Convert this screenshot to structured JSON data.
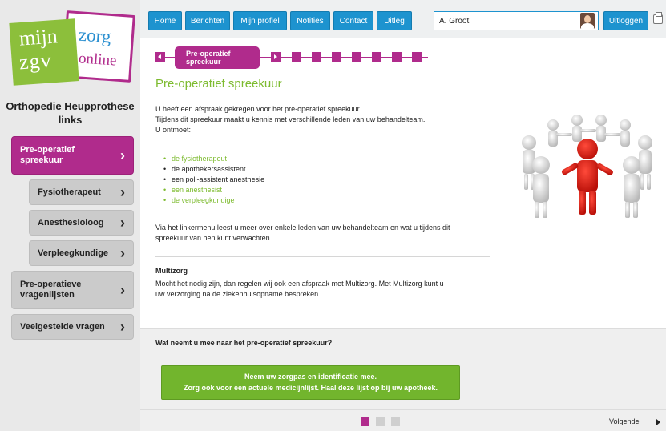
{
  "logo": {
    "word1": "mijn",
    "word2": "zorg",
    "word3": "zgv",
    "word4": "online"
  },
  "sidebar": {
    "section_title": "Orthopedie Heupprothese links",
    "items": [
      {
        "label": "Pre-operatief spreekuur",
        "active": true
      },
      {
        "label": "Fysiotherapeut"
      },
      {
        "label": "Anesthesioloog"
      },
      {
        "label": "Verpleegkundige"
      },
      {
        "label": "Pre-operatieve vragenlijsten"
      },
      {
        "label": "Veelgestelde vragen"
      }
    ]
  },
  "topbar": {
    "tabs": [
      "Home",
      "Berichten",
      "Mijn profiel",
      "Notities",
      "Contact",
      "Uitleg"
    ],
    "user_name": "A. Groot",
    "logout_label": "Uitloggen"
  },
  "progress": {
    "current_step": "Pre-operatief spreekuur",
    "total_steps": 9,
    "current_index": 1
  },
  "content": {
    "title": "Pre-operatief spreekuur",
    "intro_1": "U heeft een afspraak gekregen voor het pre-operatief spreekuur.",
    "intro_2": "Tijdens dit spreekuur maakt u kennis met verschillende leden van uw behandelteam.",
    "intro_3": "U ontmoet:",
    "meet_list": [
      {
        "text": "de fysiotherapeut",
        "link": true
      },
      {
        "text": "de apothekersassistent",
        "link": false
      },
      {
        "text": "een poli-assistent anesthesie",
        "link": false
      },
      {
        "text": "een anesthesist",
        "link": true
      },
      {
        "text": "de verpleegkundige",
        "link": true
      }
    ],
    "via_1": "Via het linkermenu leest u meer over enkele leden van uw behandelteam en wat u tijdens dit",
    "via_2": "spreekuur van hen kunt verwachten.",
    "multizorg_title": "Multizorg",
    "multizorg_1": "Mocht het nodig zijn, dan regelen wij ook een afspraak met Multizorg. Met Multizorg kunt u",
    "multizorg_2": "uw verzorging na de ziekenhuisopname bespreken.",
    "question": "Wat neemt u mee naar het pre-operatief spreekuur?",
    "green_1": "Neem uw zorgpas en identificatie mee.",
    "green_2": "Zorg ook voor een actuele medicijnlijst. Haal deze lijst op bij uw apotheek."
  },
  "footer": {
    "pages": 3,
    "current_page": 1,
    "next_label": "Volgende"
  },
  "colors": {
    "magenta": "#b02b8c",
    "blue": "#1d93cf",
    "green": "#72b52d",
    "title_green": "#7dbb2f"
  }
}
